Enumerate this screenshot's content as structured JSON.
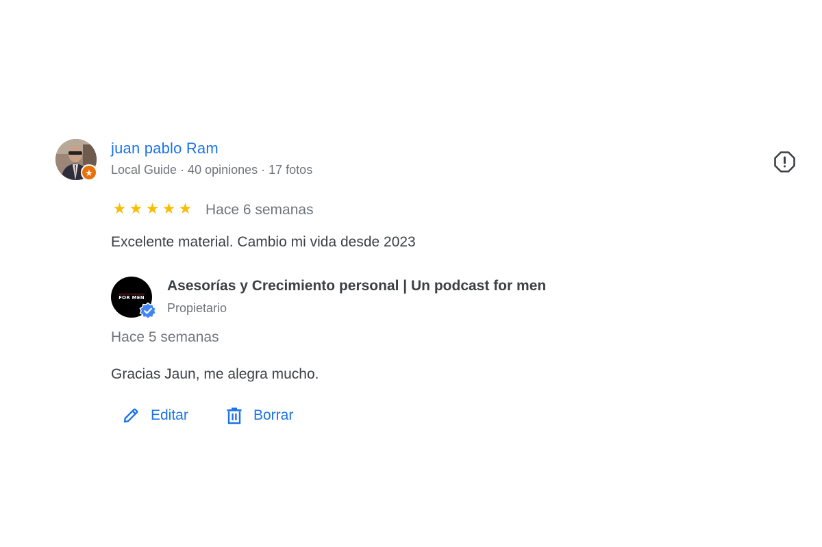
{
  "review": {
    "reviewer_name": "juan pablo Ram",
    "reviewer_meta": "Local Guide · 40 opiniones · 17 fotos",
    "rating": 5,
    "max_rating": 5,
    "stars": [
      "★",
      "★",
      "★",
      "★",
      "★"
    ],
    "date": "Hace 6 semanas",
    "text": "Excelente material. Cambio mi vida desde 2023"
  },
  "reply": {
    "owner_name": "Asesorías y Crecimiento personal | Un podcast for men",
    "owner_role": "Propietario",
    "date": "Hace 5 semanas",
    "text": "Gracias Jaun, me alegra mucho."
  },
  "actions": {
    "edit_label": "Editar",
    "delete_label": "Borrar"
  },
  "colors": {
    "link_blue": "#1a73e8",
    "star_yellow": "#fbbc04",
    "guide_orange": "#e8710a",
    "verified_blue": "#4285f4",
    "text_primary": "#3c4043",
    "text_secondary": "#70757a"
  },
  "icons": {
    "guide_badge": "star-icon",
    "report": "report-icon",
    "verified": "verified-check-icon",
    "edit": "pencil-icon",
    "delete": "trash-icon"
  }
}
